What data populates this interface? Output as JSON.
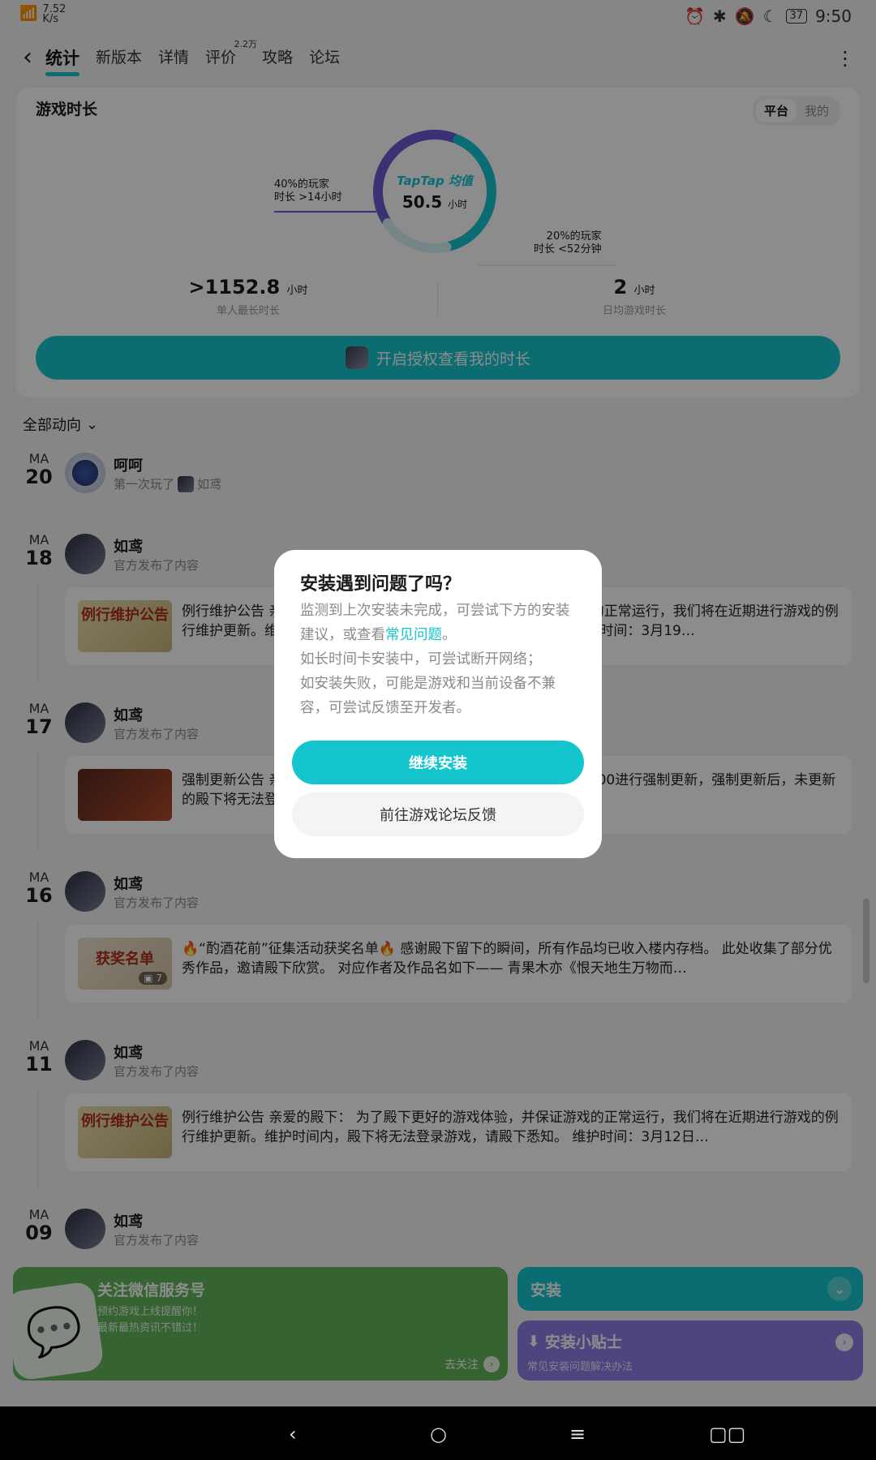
{
  "status_bar": {
    "net_speed": "7.52",
    "net_unit": "K/s",
    "battery": "37",
    "time": "9:50"
  },
  "header": {
    "back_icon": "chevron-left-icon",
    "tabs": [
      {
        "label": "统计",
        "active": true
      },
      {
        "label": "新版本"
      },
      {
        "label": "详情"
      },
      {
        "label": "评价",
        "badge": "2.2万"
      },
      {
        "label": "攻略"
      },
      {
        "label": "论坛"
      }
    ],
    "more_icon": "more-vertical-icon"
  },
  "stats": {
    "title": "游戏时长",
    "toggle": [
      "平台",
      "我的"
    ],
    "logo_text": "TapTap 均值",
    "avg_value": "50.5",
    "avg_unit": "小时",
    "note_left_1": "40%的玩家",
    "note_left_2": "时长 >14小时",
    "note_right_1": "20%的玩家",
    "note_right_2": "时长 <52分钟",
    "max_value": ">1152.8",
    "max_unit": "小时",
    "max_label": "单人最长时长",
    "daily_value": "2",
    "daily_unit": "小时",
    "daily_label": "日均游戏时长",
    "auth_button": "开启授权查看我的时长"
  },
  "filter": {
    "label": "全部动向"
  },
  "feed": [
    {
      "mon": "MA",
      "day": "20",
      "name": "呵呵",
      "sub": "第一次玩了",
      "game": "如鸢"
    },
    {
      "mon": "MA",
      "day": "18",
      "name": "如鸢",
      "sub": "官方发布了内容",
      "thumb": "例行维护公告",
      "text": "例行维护公告 亲爱的殿下： 为了殿下更好的游戏体验，并保证游戏的正常运行，我们将在近期进行游戏的例行维护更新。维护时间内，殿下将无法登录游戏，请殿下悉知。 维护时间：3月19…"
    },
    {
      "mon": "MA",
      "day": "17",
      "name": "如鸢",
      "sub": "官方发布了内容",
      "thumb": "",
      "text": "强制更新公告 亲爱的殿下： 《如鸢》游戏客户端预计在3月20日11:00进行强制更新，强制更新后，未更新的殿下将无法登录游戏，为避免殿下错过后续活动，请尽早更新…"
    },
    {
      "mon": "MA",
      "day": "16",
      "name": "如鸢",
      "sub": "官方发布了内容",
      "thumb": "获奖名单",
      "badge": "7",
      "text": "🔥“酌酒花前”征集活动获奖名单🔥 感谢殿下留下的瞬间，所有作品均已收入楼内存档。 此处收集了部分优秀作品，邀请殿下欣赏。 对应作者及作品名如下—— 青果木亦《恨天地生万物而…"
    },
    {
      "mon": "MA",
      "day": "11",
      "name": "如鸢",
      "sub": "官方发布了内容",
      "thumb": "例行维护公告",
      "text": "例行维护公告 亲爱的殿下： 为了殿下更好的游戏体验，并保证游戏的正常运行，我们将在近期进行游戏的例行维护更新。维护时间内，殿下将无法登录游戏，请殿下悉知。 维护时间：3月12日…"
    },
    {
      "mon": "MA",
      "day": "09",
      "name": "如鸢",
      "sub": "官方发布了内容"
    }
  ],
  "bottom": {
    "wechat_title": "关注微信服务号",
    "wechat_line1": "预约游戏上线提醒你！",
    "wechat_line2": "最新最热资讯不错过！",
    "wechat_follow": "去关注",
    "install": "安装",
    "tips_title": "安装小贴士",
    "tips_sub": "常见安装问题解决办法"
  },
  "dialog": {
    "title": "安装遇到问题了吗？",
    "body_1": "监测到上次安装未完成，可尝试下方的安装建议，或查看",
    "link": "常见问题",
    "body_1_end": "。",
    "body_2": "如长时间卡安装中，可尝试断开网络；",
    "body_3": "如安装失败，可能是游戏和当前设备不兼容，可尝试反馈至开发者。",
    "primary": "继续安装",
    "secondary": "前往游戏论坛反馈"
  },
  "colors": {
    "accent": "#15c5ce",
    "purple": "#6b5bd6",
    "wechat_green": "#62b45a",
    "tips_purple": "#8a7ee6"
  },
  "donut_chart": {
    "type": "donut",
    "segments": [
      {
        "label": "40%的玩家 时长 >14小时",
        "share": 40,
        "color": "#6b5bd6"
      },
      {
        "label": "",
        "share": 40,
        "color": "#15c5ce"
      },
      {
        "label": "20%的玩家 时长 <52分钟",
        "share": 20,
        "color": "#d7f3f2"
      }
    ]
  }
}
